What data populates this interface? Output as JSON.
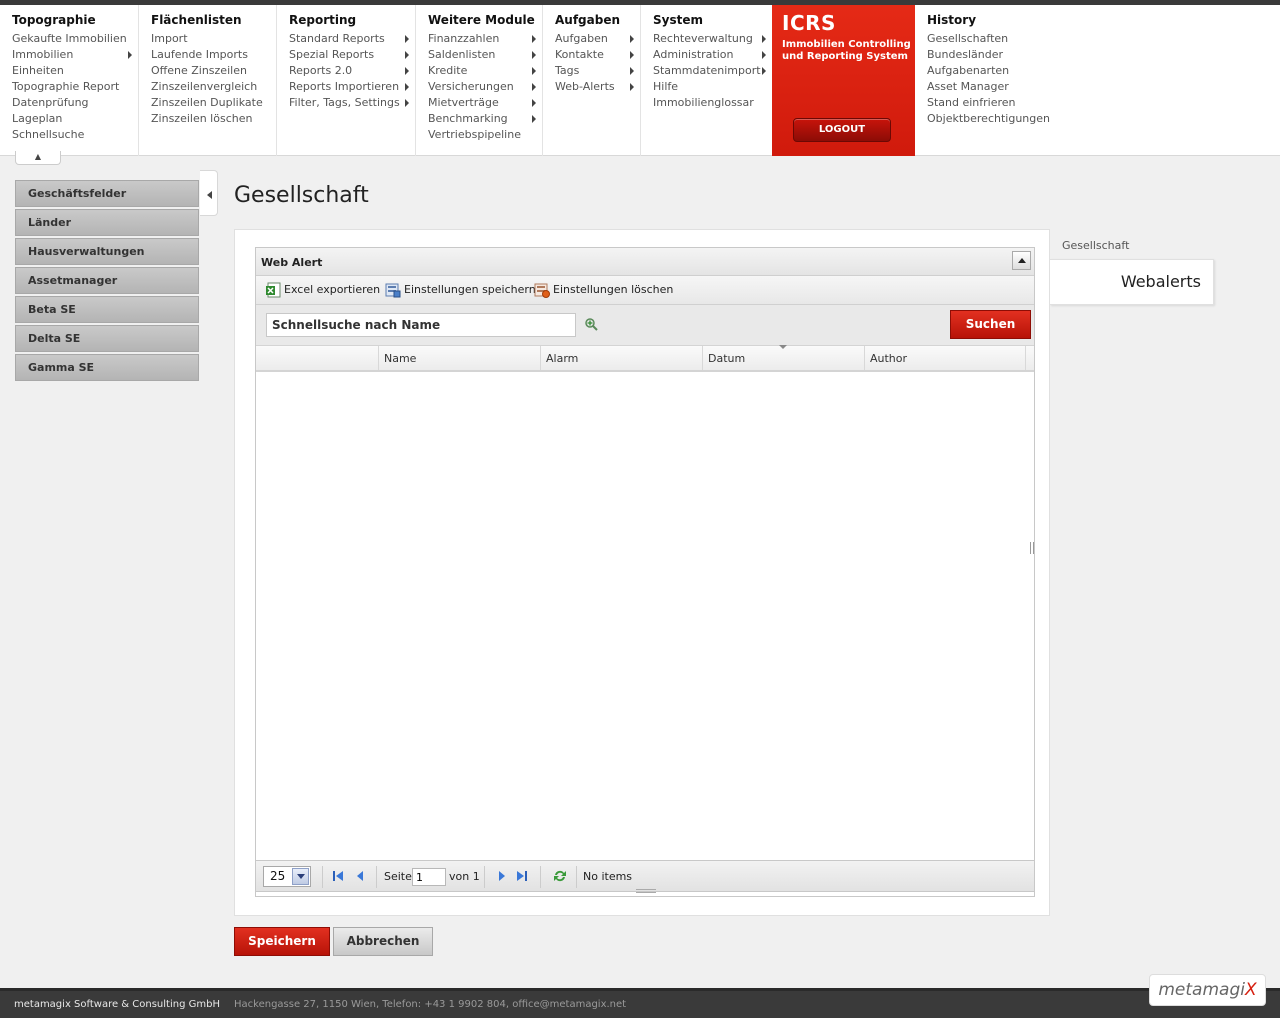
{
  "menu": [
    {
      "title": "Topographie",
      "items": [
        {
          "label": "Gekaufte Immobilien",
          "sub": false
        },
        {
          "label": "Immobilien",
          "sub": true
        },
        {
          "label": "Einheiten",
          "sub": false
        },
        {
          "label": "Topographie Report",
          "sub": false
        },
        {
          "label": "Datenprüfung",
          "sub": false
        },
        {
          "label": "Lageplan",
          "sub": false
        },
        {
          "label": "Schnellsuche",
          "sub": false
        }
      ]
    },
    {
      "title": "Flächenlisten",
      "items": [
        {
          "label": "Import",
          "sub": false
        },
        {
          "label": "Laufende Imports",
          "sub": false
        },
        {
          "label": "Offene Zinszeilen",
          "sub": false
        },
        {
          "label": "Zinszeilenvergleich",
          "sub": false
        },
        {
          "label": "Zinszeilen Duplikate",
          "sub": false
        },
        {
          "label": "Zinszeilen löschen",
          "sub": false
        }
      ]
    },
    {
      "title": "Reporting",
      "items": [
        {
          "label": "Standard Reports",
          "sub": true
        },
        {
          "label": "Spezial Reports",
          "sub": true
        },
        {
          "label": "Reports 2.0",
          "sub": true
        },
        {
          "label": "Reports Importieren",
          "sub": true
        },
        {
          "label": "Filter, Tags, Settings",
          "sub": true
        }
      ]
    },
    {
      "title": "Weitere Module",
      "items": [
        {
          "label": "Finanzzahlen",
          "sub": true
        },
        {
          "label": "Saldenlisten",
          "sub": true
        },
        {
          "label": "Kredite",
          "sub": true
        },
        {
          "label": "Versicherungen",
          "sub": true
        },
        {
          "label": "Mietverträge",
          "sub": true
        },
        {
          "label": "Benchmarking",
          "sub": true
        },
        {
          "label": "Vertriebspipeline",
          "sub": false
        }
      ]
    },
    {
      "title": "Aufgaben",
      "items": [
        {
          "label": "Aufgaben",
          "sub": true
        },
        {
          "label": "Kontakte",
          "sub": true
        },
        {
          "label": "Tags",
          "sub": true
        },
        {
          "label": "Web-Alerts",
          "sub": true
        }
      ]
    },
    {
      "title": "System",
      "items": [
        {
          "label": "Rechteverwaltung",
          "sub": true
        },
        {
          "label": "Administration",
          "sub": true
        },
        {
          "label": "Stammdatenimport",
          "sub": true
        },
        {
          "label": "Hilfe",
          "sub": false
        },
        {
          "label": "Immobilienglossar",
          "sub": false
        }
      ]
    }
  ],
  "history": {
    "title": "History",
    "items": [
      {
        "label": "Gesellschaften",
        "sub": false
      },
      {
        "label": "Bundesländer",
        "sub": false
      },
      {
        "label": "Aufgabenarten",
        "sub": false
      },
      {
        "label": "Asset Manager",
        "sub": false
      },
      {
        "label": "Stand einfrieren",
        "sub": false
      },
      {
        "label": "Objektberechtigungen",
        "sub": false
      }
    ]
  },
  "icrs": {
    "title": "ICRS",
    "subtitle": "Immobilien Controlling und Reporting System",
    "logout": "LOGOUT"
  },
  "sidebar": {
    "items": [
      "Geschäftsfelder",
      "Länder",
      "Hausverwaltungen",
      "Assetmanager",
      "Beta SE",
      "Delta SE",
      "Gamma SE"
    ]
  },
  "page": {
    "title": "Gesellschaft"
  },
  "right_tabs": {
    "label": "Gesellschaft",
    "active": "Webalerts"
  },
  "grid": {
    "title": "Web Alert",
    "toolbar": {
      "excel": "Excel exportieren",
      "save_settings": "Einstellungen speichern",
      "delete_settings": "Einstellungen löschen"
    },
    "search": {
      "value": "Schnellsuche nach Name",
      "button": "Suchen"
    },
    "columns": [
      "Name",
      "Alarm",
      "Datum",
      "Author"
    ],
    "pager": {
      "page_size": "25",
      "page_label": "Seite",
      "page_value": "1",
      "of_label": "von 1",
      "status": "No items"
    }
  },
  "actions": {
    "save": "Speichern",
    "cancel": "Abbrechen"
  },
  "footer": {
    "company": "metamagix Software & Consulting GmbH",
    "address": "Hackengasse 27, 1150 Wien, Telefon: +43 1 9902 804, office@metamagix.net"
  },
  "logo": {
    "text": "metamagi",
    "accent": "X"
  },
  "colors": {
    "accent_red": "#d01a0c",
    "footer_bg": "#3a3a3a"
  }
}
